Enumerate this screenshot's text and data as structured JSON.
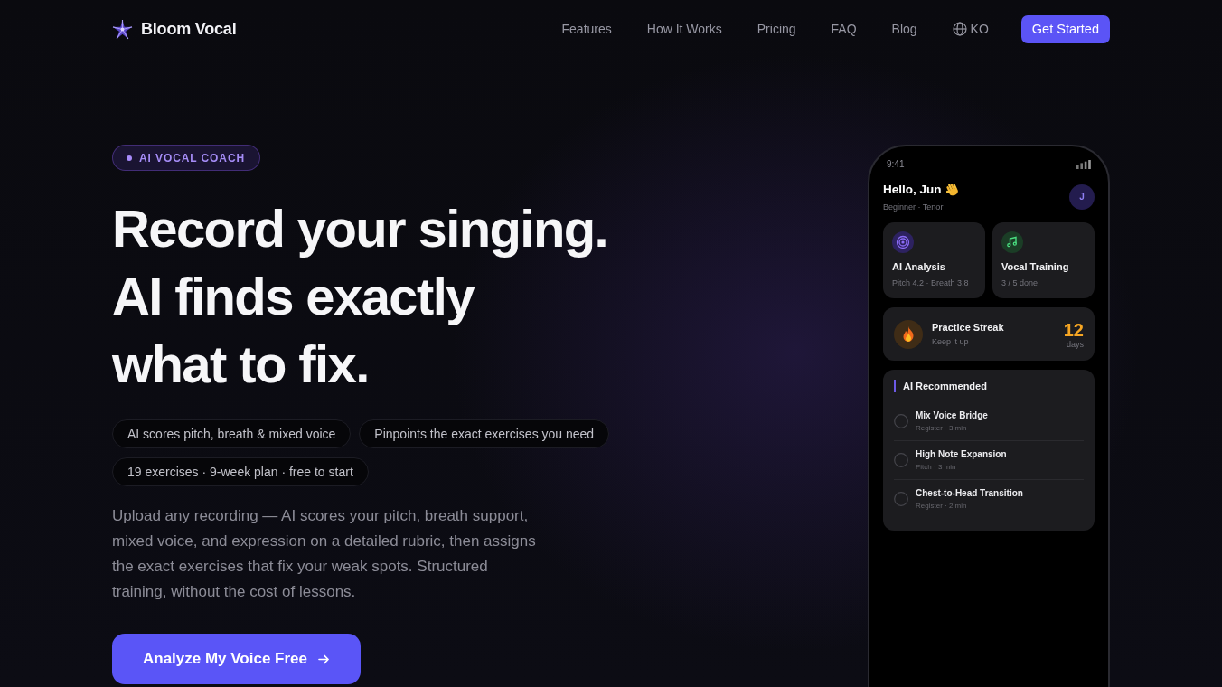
{
  "nav": {
    "logo": "Bloom Vocal",
    "links": [
      "Features",
      "How It Works",
      "Pricing",
      "FAQ",
      "Blog"
    ],
    "language": "KO",
    "cta": "Get Started"
  },
  "hero": {
    "badge": "AI VOCAL COACH",
    "headline": [
      "Record your singing.",
      "AI finds exactly",
      "what to fix."
    ],
    "pills": [
      "AI scores pitch, breath & mixed voice",
      "Pinpoints the exact exercises you need",
      "19 exercises · 9-week plan · free to start"
    ],
    "description": "Upload any recording — AI scores your pitch, breath support, mixed voice, and expression on a detailed rubric, then assigns the exact exercises that fix your weak spots. Structured training, without the cost of lessons.",
    "cta": "Analyze My Voice Free"
  },
  "phone": {
    "status_time": "9:41",
    "greeting": "Hello, Jun",
    "profile": "Beginner · Tenor",
    "avatar": "J",
    "cards": [
      {
        "kind": "analysis",
        "title": "AI Analysis",
        "detail": "Pitch 4.2 · Breath 3.8"
      },
      {
        "kind": "training",
        "title": "Vocal Training",
        "detail": "3 / 5 done"
      }
    ],
    "streak": {
      "title": "Practice Streak",
      "detail": "Keep it up",
      "count": "12",
      "unit": "days"
    },
    "recommended": {
      "title": "AI Recommended",
      "items": [
        {
          "title": "Mix Voice Bridge",
          "detail": "Register · 3 min",
          "checked": false
        },
        {
          "title": "High Note Expansion",
          "detail": "Pitch · 3 min",
          "checked": false
        },
        {
          "title": "Chest-to-Head Transition",
          "detail": "Register · 2 min",
          "checked": false
        }
      ]
    }
  }
}
